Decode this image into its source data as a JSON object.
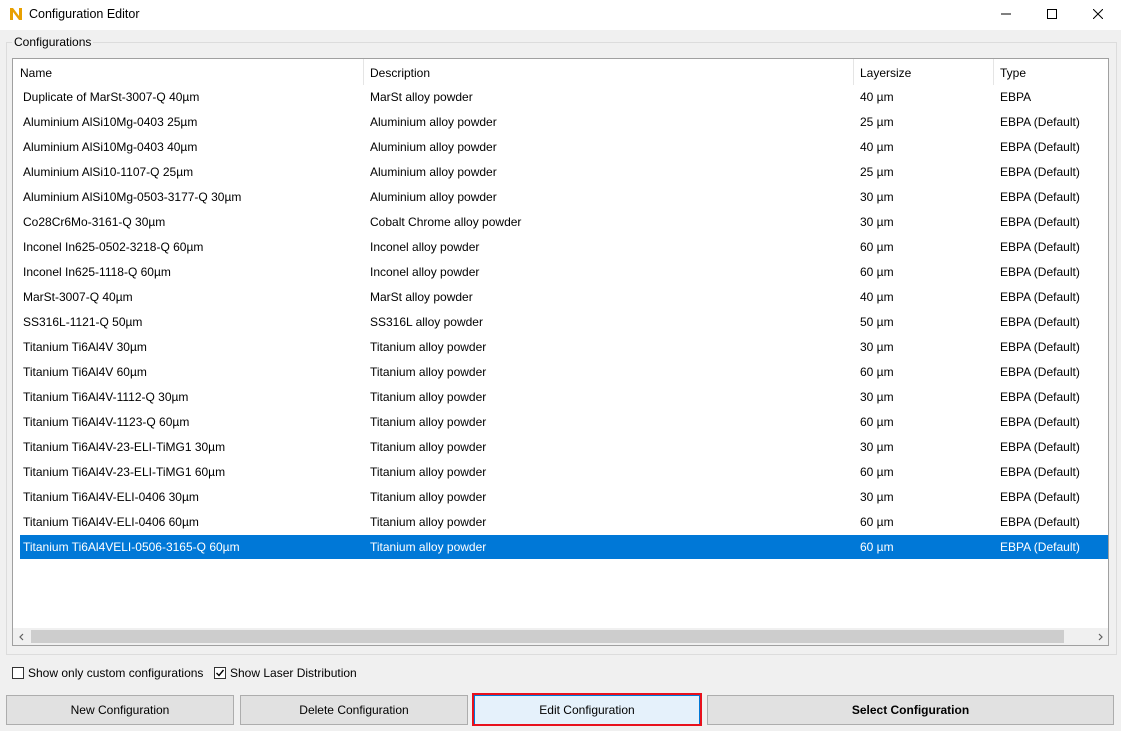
{
  "window": {
    "title": "Configuration Editor",
    "controls": {
      "minimize": "minimize-icon",
      "maximize": "maximize-icon",
      "close": "close-icon"
    }
  },
  "group": {
    "label": "Configurations"
  },
  "table": {
    "columns": [
      "Name",
      "Description",
      "Layersize",
      "Type"
    ],
    "rows": [
      {
        "name": "Duplicate of MarSt-3007-Q 40µm",
        "description": "MarSt alloy powder",
        "layersize": "40 µm",
        "type": "EBPA"
      },
      {
        "name": "Aluminium AlSi10Mg-0403 25µm",
        "description": "Aluminium alloy powder",
        "layersize": "25 µm",
        "type": "EBPA (Default)"
      },
      {
        "name": "Aluminium AlSi10Mg-0403 40µm",
        "description": "Aluminium alloy powder",
        "layersize": "40 µm",
        "type": "EBPA (Default)"
      },
      {
        "name": "Aluminium AlSi10-1107-Q 25µm",
        "description": "Aluminium alloy powder",
        "layersize": "25 µm",
        "type": "EBPA (Default)"
      },
      {
        "name": "Aluminium AlSi10Mg-0503-3177-Q 30µm",
        "description": "Aluminium alloy powder",
        "layersize": "30 µm",
        "type": "EBPA (Default)"
      },
      {
        "name": "Co28Cr6Mo-3161-Q 30µm",
        "description": "Cobalt Chrome alloy powder",
        "layersize": "30 µm",
        "type": "EBPA (Default)"
      },
      {
        "name": "Inconel In625-0502-3218-Q 60µm",
        "description": "Inconel alloy powder",
        "layersize": "60 µm",
        "type": "EBPA (Default)"
      },
      {
        "name": "Inconel In625-1118-Q 60µm",
        "description": "Inconel alloy powder",
        "layersize": "60 µm",
        "type": "EBPA (Default)"
      },
      {
        "name": "MarSt-3007-Q 40µm",
        "description": "MarSt alloy powder",
        "layersize": "40 µm",
        "type": "EBPA (Default)"
      },
      {
        "name": "SS316L-1121-Q 50µm",
        "description": "SS316L alloy powder",
        "layersize": "50 µm",
        "type": "EBPA (Default)"
      },
      {
        "name": "Titanium Ti6Al4V 30µm",
        "description": "Titanium alloy powder",
        "layersize": "30 µm",
        "type": "EBPA (Default)"
      },
      {
        "name": "Titanium Ti6Al4V 60µm",
        "description": "Titanium alloy powder",
        "layersize": "60 µm",
        "type": "EBPA (Default)"
      },
      {
        "name": "Titanium Ti6Al4V-1112-Q 30µm",
        "description": "Titanium alloy powder",
        "layersize": "30 µm",
        "type": "EBPA (Default)"
      },
      {
        "name": "Titanium Ti6Al4V-1123-Q 60µm",
        "description": "Titanium alloy powder",
        "layersize": "60 µm",
        "type": "EBPA (Default)"
      },
      {
        "name": "Titanium Ti6Al4V-23-ELI-TiMG1 30µm",
        "description": "Titanium alloy powder",
        "layersize": "30 µm",
        "type": "EBPA (Default)"
      },
      {
        "name": "Titanium Ti6Al4V-23-ELI-TiMG1 60µm",
        "description": "Titanium alloy powder",
        "layersize": "60 µm",
        "type": "EBPA (Default)"
      },
      {
        "name": "Titanium Ti6Al4V-ELI-0406 30µm",
        "description": "Titanium alloy powder",
        "layersize": "30 µm",
        "type": "EBPA (Default)"
      },
      {
        "name": "Titanium Ti6Al4V-ELI-0406 60µm",
        "description": "Titanium alloy powder",
        "layersize": "60 µm",
        "type": "EBPA (Default)"
      },
      {
        "name": "Titanium Ti6Al4VELI-0506-3165-Q 60µm",
        "description": "Titanium alloy powder",
        "layersize": "60 µm",
        "type": "EBPA (Default)",
        "selected": true
      }
    ]
  },
  "options": {
    "show_custom": {
      "label": "Show only custom configurations",
      "checked": false
    },
    "show_laser": {
      "label": "Show Laser Distribution",
      "checked": true
    }
  },
  "buttons": {
    "new": "New Configuration",
    "delete": "Delete Configuration",
    "edit": "Edit Configuration",
    "select": "Select Configuration"
  },
  "colors": {
    "selection": "#0078d7",
    "focus_highlight": "#e8111c",
    "app_icon": "#e8a000"
  }
}
